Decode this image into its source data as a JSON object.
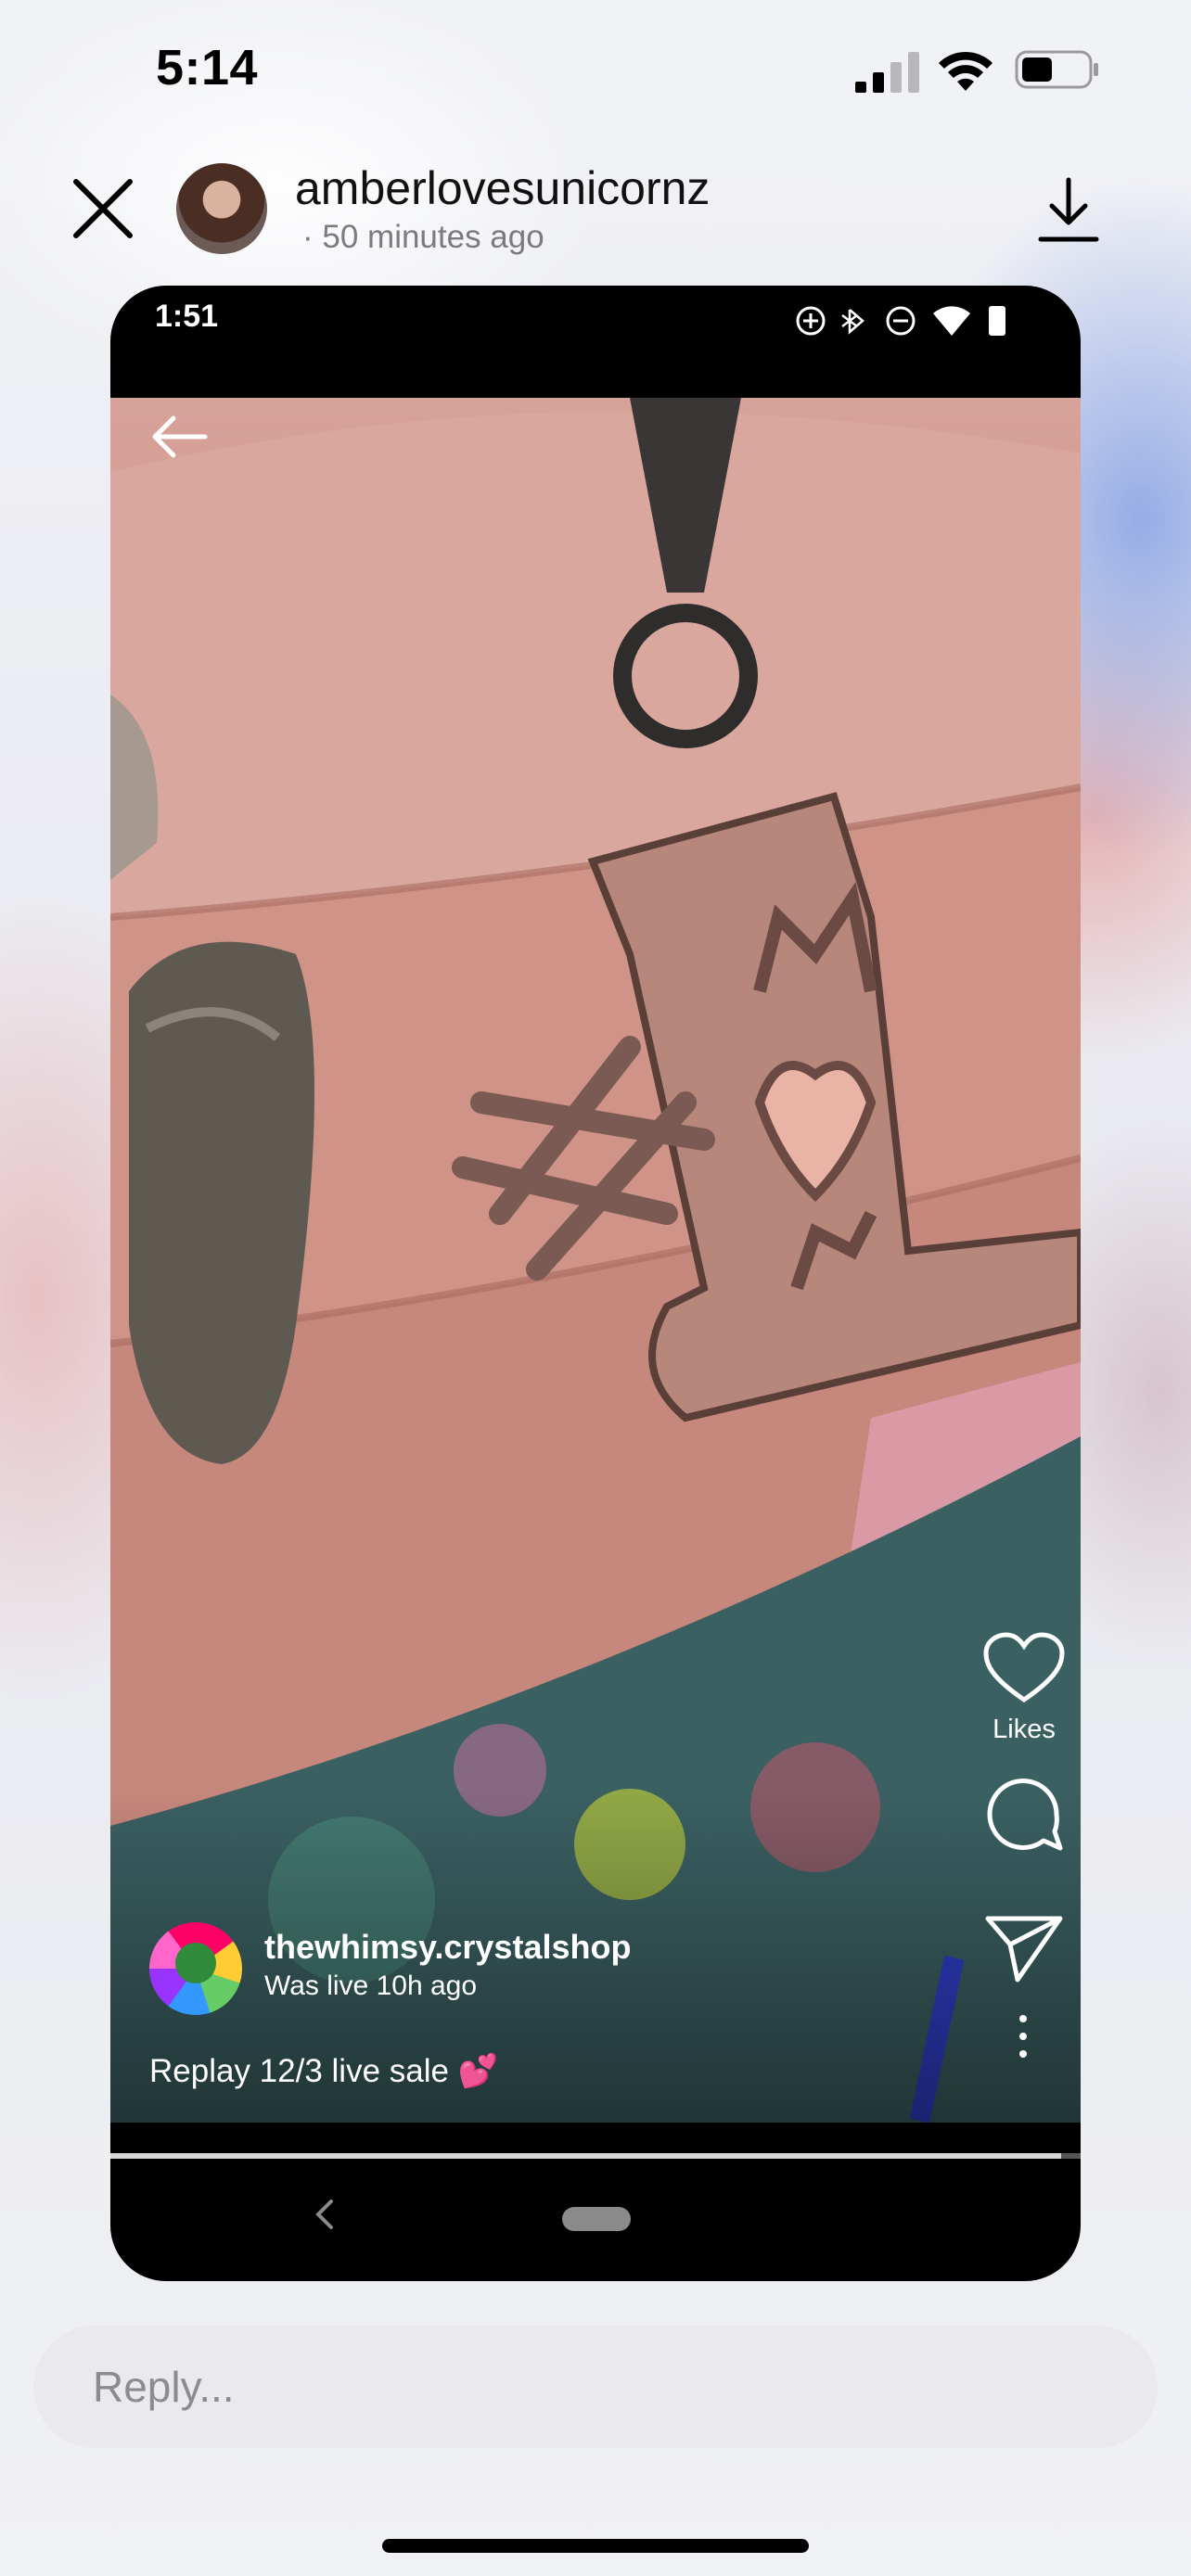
{
  "status_bar": {
    "time": "5:14"
  },
  "story": {
    "username": "amberlovesunicornz",
    "time_ago": "· 50 minutes ago"
  },
  "video": {
    "device_time": "1:51",
    "actions": {
      "likes_label": "Likes"
    },
    "shop": {
      "name": "thewhimsy.crystalshop",
      "subtitle": "Was live 10h ago"
    },
    "caption": "Replay 12/3 live sale 💕",
    "progress": 0.98
  },
  "reply": {
    "placeholder": "Reply..."
  },
  "icons": [
    "close-icon",
    "download-icon",
    "back-arrow-icon",
    "heart-icon",
    "comment-icon",
    "send-icon",
    "more-icon"
  ]
}
